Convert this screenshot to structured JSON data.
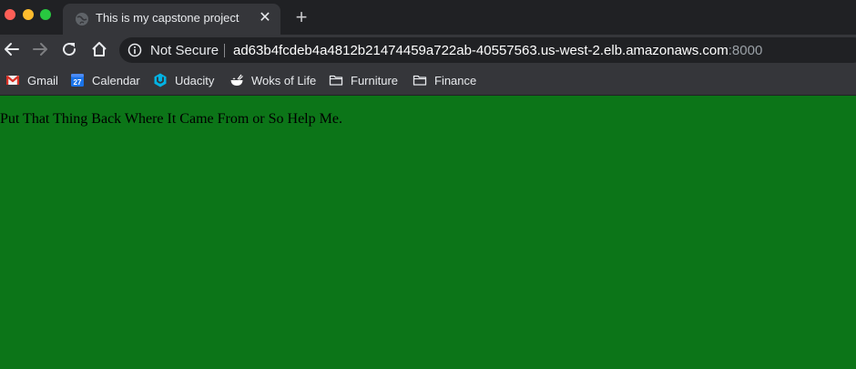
{
  "tab": {
    "title": "This is my capstone project",
    "close_glyph": "✕"
  },
  "new_tab_glyph": "+",
  "toolbar": {
    "back_icon": "arrow-left-icon",
    "forward_icon": "arrow-right-icon",
    "reload_icon": "reload-icon",
    "home_icon": "home-icon"
  },
  "omnibox": {
    "security_label": "Not Secure",
    "url_host": "ad63b4fcdeb4a4812b21474459a722ab-40557563.us-west-2.elb.amazonaws.com",
    "url_port": ":8000"
  },
  "bookmarks": [
    {
      "label": "Gmail",
      "icon": "gmail-icon"
    },
    {
      "label": "Calendar",
      "icon": "calendar-icon",
      "icon_text": "27"
    },
    {
      "label": "Udacity",
      "icon": "udacity-icon"
    },
    {
      "label": "Woks of Life",
      "icon": "bowl-icon"
    },
    {
      "label": "Furniture",
      "icon": "folder-icon"
    },
    {
      "label": "Finance",
      "icon": "folder-icon"
    }
  ],
  "page": {
    "background_color": "#0c7518",
    "text": "Put That Thing Back Where It Came From or So Help Me."
  }
}
